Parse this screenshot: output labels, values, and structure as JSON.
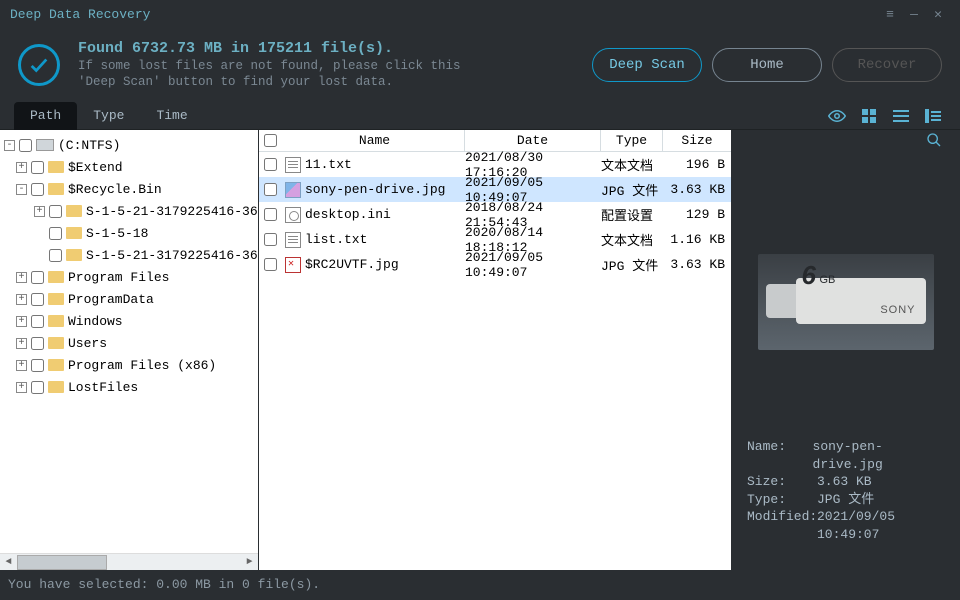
{
  "app": {
    "title": "Deep Data Recovery"
  },
  "header": {
    "found": "Found 6732.73 MB in 175211 file(s).",
    "hint1": "If some lost files are not found, please click this",
    "hint2": "'Deep Scan' button to find your lost data.",
    "deep_scan": "Deep Scan",
    "home": "Home",
    "recover": "Recover"
  },
  "tabs": {
    "path": "Path",
    "type": "Type",
    "time": "Time"
  },
  "tree": {
    "root": "(C:NTFS)",
    "items": [
      {
        "depth": 1,
        "expand": "+",
        "label": "$Extend"
      },
      {
        "depth": 1,
        "expand": "-",
        "label": "$Recycle.Bin"
      },
      {
        "depth": 2,
        "expand": "+",
        "label": "S-1-5-21-3179225416-36"
      },
      {
        "depth": 2,
        "expand": "",
        "label": "S-1-5-18"
      },
      {
        "depth": 2,
        "expand": "",
        "label": "S-1-5-21-3179225416-36"
      },
      {
        "depth": 1,
        "expand": "+",
        "label": "Program Files"
      },
      {
        "depth": 1,
        "expand": "+",
        "label": "ProgramData"
      },
      {
        "depth": 1,
        "expand": "+",
        "label": "Windows"
      },
      {
        "depth": 1,
        "expand": "+",
        "label": "Users"
      },
      {
        "depth": 1,
        "expand": "+",
        "label": "Program Files (x86)"
      },
      {
        "depth": 1,
        "expand": "+",
        "label": "LostFiles"
      }
    ]
  },
  "columns": {
    "name": "Name",
    "date": "Date",
    "type": "Type",
    "size": "Size"
  },
  "files": [
    {
      "icon": "txt",
      "name": "11.txt",
      "date": "2021/08/30 17:16:20",
      "type": "文本文档",
      "size": "196  B",
      "selected": false
    },
    {
      "icon": "img",
      "name": "sony-pen-drive.jpg",
      "date": "2021/09/05 10:49:07",
      "type": "JPG 文件",
      "size": "3.63 KB",
      "selected": true
    },
    {
      "icon": "ini",
      "name": "desktop.ini",
      "date": "2018/08/24 21:54:43",
      "type": "配置设置",
      "size": "129  B",
      "selected": false
    },
    {
      "icon": "txt",
      "name": "list.txt",
      "date": "2020/08/14 18:18:12",
      "type": "文本文档",
      "size": "1.16 KB",
      "selected": false
    },
    {
      "icon": "broken",
      "name": "$RC2UVTF.jpg",
      "date": "2021/09/05 10:49:07",
      "type": "JPG 文件",
      "size": "3.63 KB",
      "selected": false
    }
  ],
  "meta": {
    "name_k": "Name:",
    "name_v": "sony-pen-drive.jpg",
    "size_k": "Size:",
    "size_v": "3.63 KB",
    "type_k": "Type:",
    "type_v": "JPG 文件",
    "mod_k": "Modified:",
    "mod_v": "2021/09/05 10:49:07"
  },
  "status": "You have selected: 0.00 MB in 0 file(s)."
}
